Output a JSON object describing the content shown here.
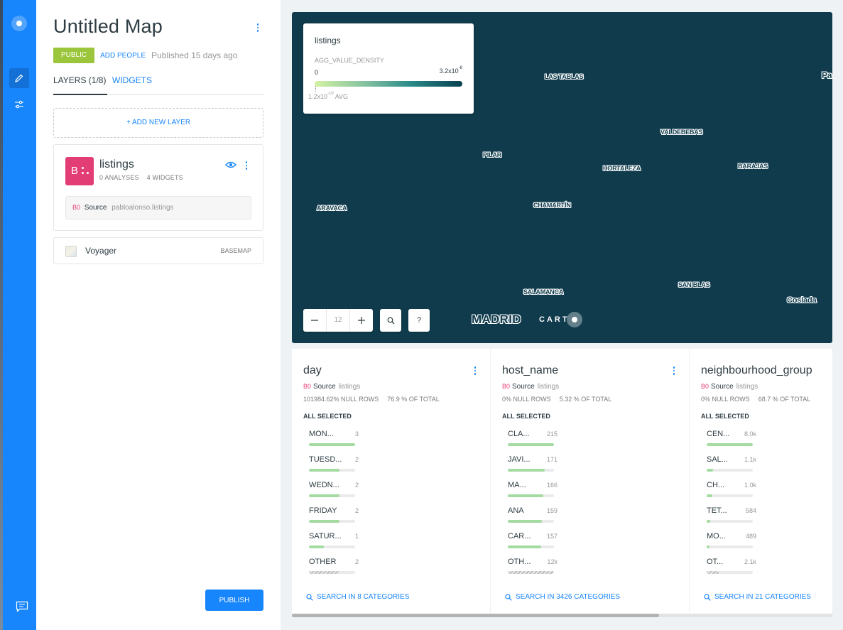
{
  "toolbar": {
    "icons": [
      "carto-logo-icon",
      "pencil-icon",
      "settings-sliders-icon",
      "chat-icon"
    ]
  },
  "panel": {
    "title": "Untitled Map",
    "privacy": "PUBLIC",
    "add_people": "ADD PEOPLE",
    "published": "Published 15 days ago",
    "tabs": [
      {
        "label": "LAYERS (1/8)"
      },
      {
        "label": "WIDGETS"
      }
    ],
    "add_layer": "+ ADD NEW LAYER",
    "layer": {
      "letter": "B",
      "name": "listings",
      "analyses": "0 ANALYSES",
      "widgets": "4 WIDGETS",
      "source_id": "B0",
      "source_word": "Source",
      "source_table": "pabloalonso.listings"
    },
    "basemap": {
      "name": "Voyager",
      "tag": "BASEMAP"
    },
    "publish": "PUBLISH"
  },
  "legend": {
    "title": "listings",
    "metric": "AGG_VALUE_DENSITY",
    "min": "0",
    "max_base": "3.2x10",
    "max_exp": "-8",
    "avg_base": "1.2x10",
    "avg_exp": "-10",
    "avg_suffix": " AVG",
    "colors": [
      "#d3f2a3",
      "#82c0a0",
      "#2a8a88",
      "#074050"
    ]
  },
  "map": {
    "background": "#0f3b4c",
    "zoom": "12",
    "labels": [
      "LAS TABLAS",
      "VALDEBEBAS",
      "PILAR",
      "HORTALEZA",
      "BARAJAS",
      "ARAVACA",
      "CHAMARTÍN",
      "SALAMANCA",
      "SAN BLAS",
      "Coslada",
      "MADRID",
      "Pa"
    ],
    "help": "?",
    "carto_text": "CART"
  },
  "widgets": [
    {
      "title": "day",
      "source_id": "B0",
      "source_word": "Source",
      "source_table": "listings",
      "nulls": "101984.62% NULL ROWS",
      "total": "76.9 % OF TOTAL",
      "selected": "ALL SELECTED",
      "categories": [
        {
          "name": "MON...",
          "value": "3",
          "fill": 1.0
        },
        {
          "name": "TUESD...",
          "value": "2",
          "fill": 0.66
        },
        {
          "name": "WEDN...",
          "value": "2",
          "fill": 0.66
        },
        {
          "name": "FRIDAY",
          "value": "2",
          "fill": 0.66
        },
        {
          "name": "SATUR...",
          "value": "1",
          "fill": 0.33
        },
        {
          "name": "OTHER",
          "value": "2",
          "fill": 0.66,
          "other": true
        }
      ],
      "search": "SEARCH IN 8 CATEGORIES"
    },
    {
      "title": "host_name",
      "source_id": "B0",
      "source_word": "Source",
      "source_table": "listings",
      "nulls": "0% NULL ROWS",
      "total": "5.32 % OF TOTAL",
      "selected": "ALL SELECTED",
      "categories": [
        {
          "name": "CLA...",
          "value": "215",
          "fill": 1.0
        },
        {
          "name": "JAVI...",
          "value": "171",
          "fill": 0.8
        },
        {
          "name": "MA...",
          "value": "166",
          "fill": 0.77
        },
        {
          "name": "ANA",
          "value": "159",
          "fill": 0.74
        },
        {
          "name": "CAR...",
          "value": "157",
          "fill": 0.73
        },
        {
          "name": "OTH...",
          "value": "12k",
          "fill": 1.0,
          "other": true
        }
      ],
      "search": "SEARCH IN 3426 CATEGORIES"
    },
    {
      "title": "neighbourhood_group",
      "source_id": "B0",
      "source_word": "Source",
      "source_table": "listings",
      "nulls": "0% NULL ROWS",
      "total": "68.7 % OF TOTAL",
      "selected": "ALL SELECTED",
      "categories": [
        {
          "name": "CEN...",
          "value": "8.0k",
          "fill": 1.0
        },
        {
          "name": "SAL...",
          "value": "1.1k",
          "fill": 0.14
        },
        {
          "name": "CH...",
          "value": "1.0k",
          "fill": 0.13
        },
        {
          "name": "TET...",
          "value": "584",
          "fill": 0.07
        },
        {
          "name": "MO...",
          "value": "489",
          "fill": 0.06
        },
        {
          "name": "OT...",
          "value": "2.1k",
          "fill": 0.26,
          "other": true
        }
      ],
      "search": "SEARCH IN 21 CATEGORIES"
    }
  ]
}
